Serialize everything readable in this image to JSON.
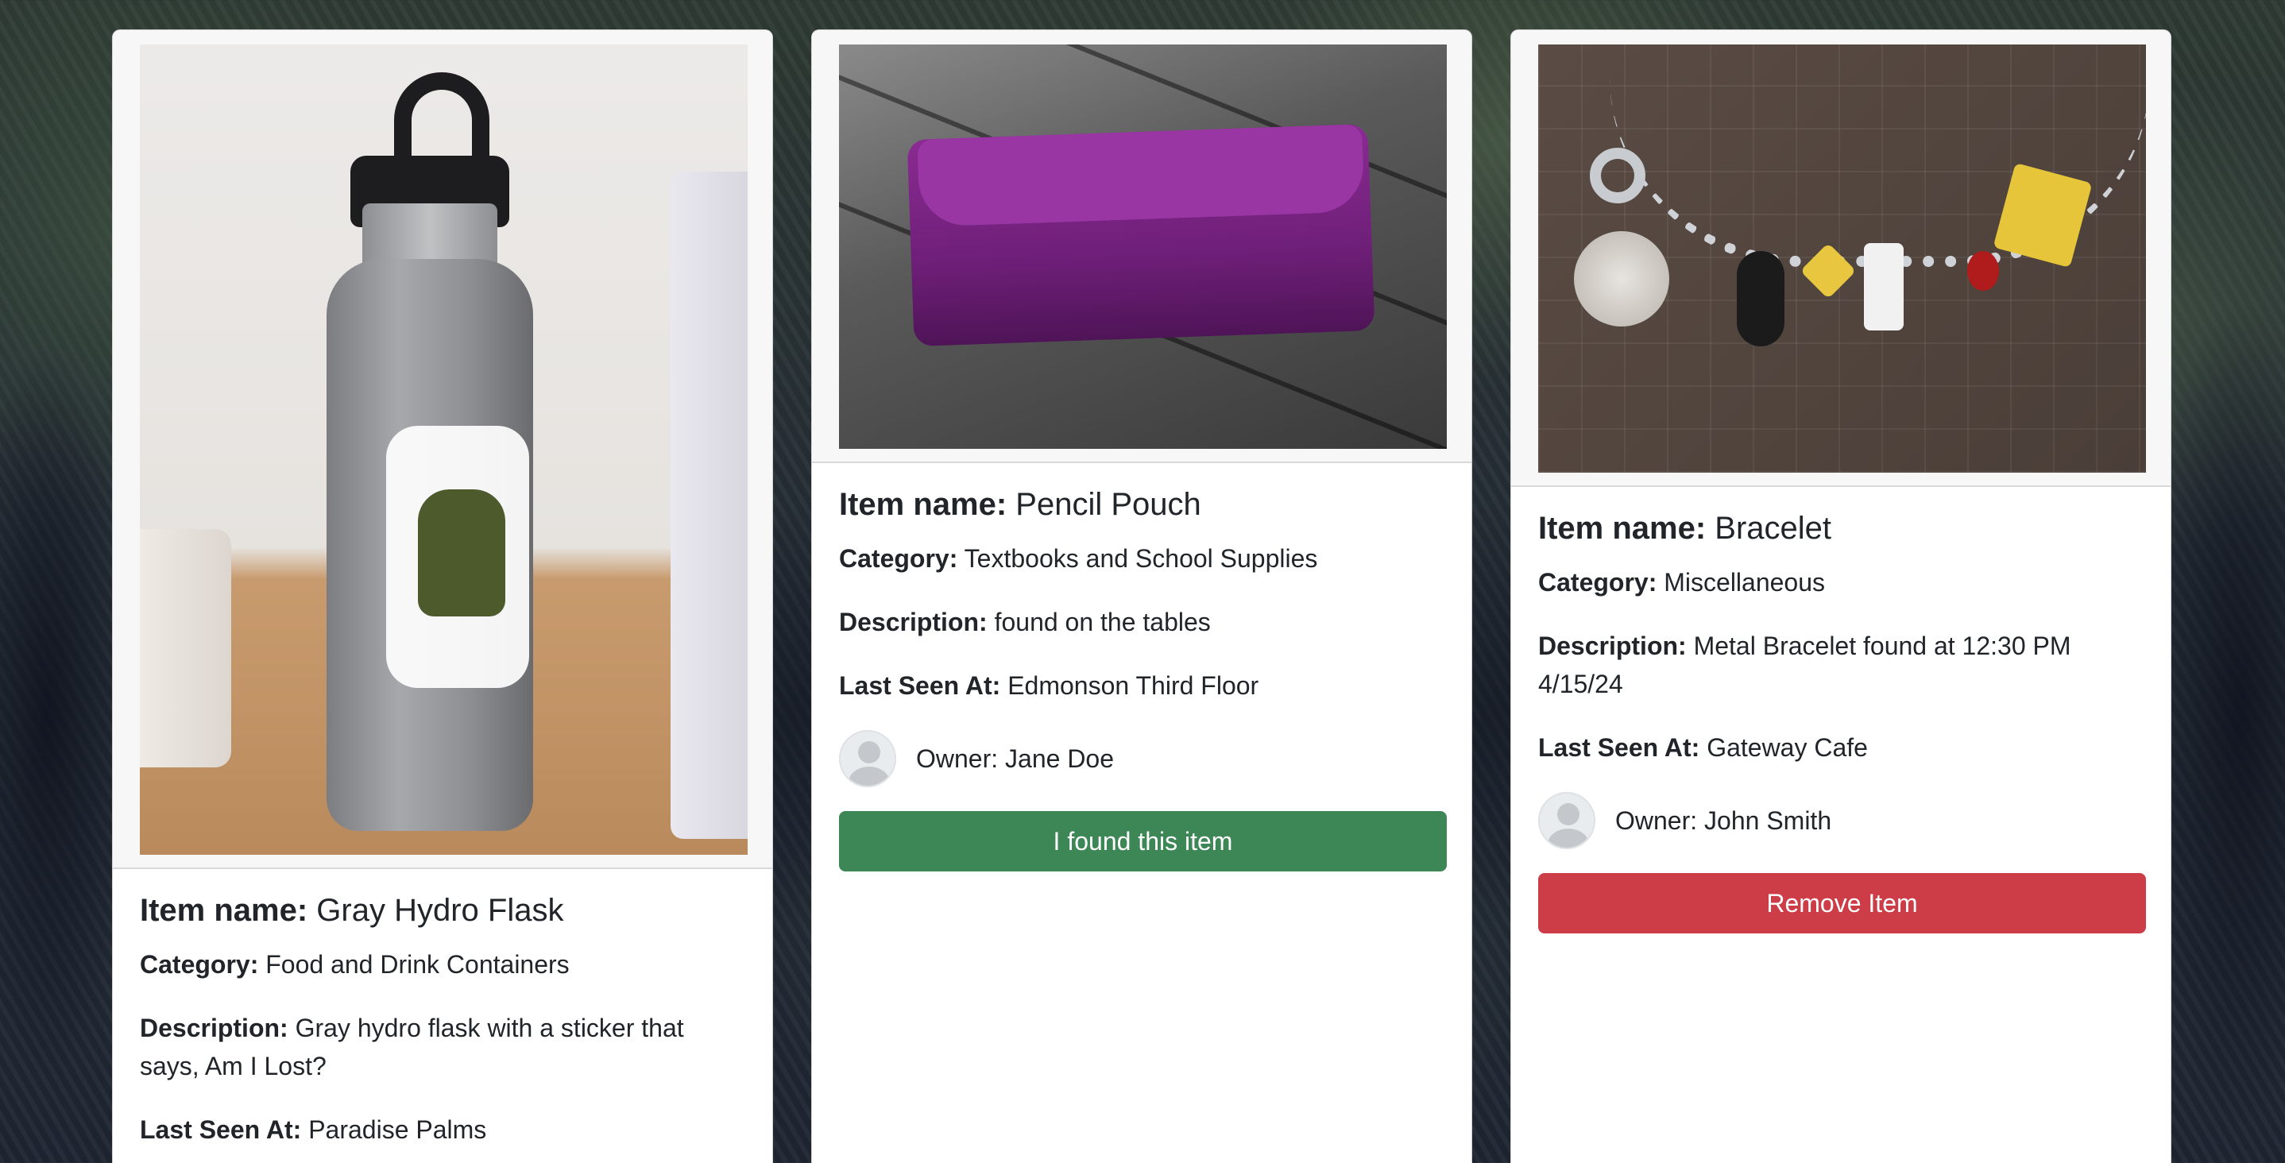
{
  "cards": [
    {
      "title_label": "Item name:",
      "title_value": "Gray Hydro Flask",
      "category_label": "Category:",
      "category_value": "Food and Drink Containers",
      "description_label": "Description:",
      "description_value": "Gray hydro flask with a sticker that says, Am I Lost?",
      "last_seen_label": "Last Seen At:",
      "last_seen_value": "Paradise Palms",
      "image_alt": "Gray Hydro Flask"
    },
    {
      "title_label": "Item name:",
      "title_value": "Pencil Pouch",
      "category_label": "Category:",
      "category_value": "Textbooks and School Supplies",
      "description_label": "Description:",
      "description_value": "found on the tables",
      "last_seen_label": "Last Seen At:",
      "last_seen_value": "Edmonson Third Floor",
      "owner_text": "Owner: Jane Doe",
      "button_label": "I found this item",
      "image_alt": "Pencil Pouch"
    },
    {
      "title_label": "Item name:",
      "title_value": "Bracelet",
      "category_label": "Category:",
      "category_value": "Miscellaneous",
      "description_label": "Description:",
      "description_value": "Metal Bracelet found at 12:30 PM 4/15/24",
      "last_seen_label": "Last Seen At:",
      "last_seen_value": "Gateway Cafe",
      "owner_text": "Owner: John Smith",
      "button_label": "Remove Item",
      "image_alt": "Bracelet"
    }
  ],
  "colors": {
    "found_button": "#3d8656",
    "remove_button": "#cc3d47",
    "card_header_bg": "#f7f7f7"
  }
}
